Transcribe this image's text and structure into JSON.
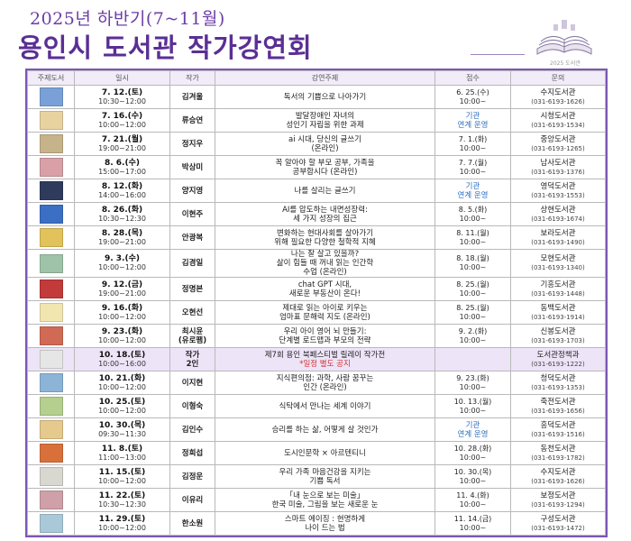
{
  "header": {
    "subtitle": "2025년 하반기(7~11월)",
    "title": "용인시 도서관 작가강연회",
    "logo_caption": "2025 도서관",
    "logo_icon": "open-book-icon",
    "accent": "#5a2f94"
  },
  "table": {
    "columns": [
      "주제도서",
      "일시",
      "작가",
      "강연주제",
      "접수",
      "문의"
    ],
    "rows": [
      {
        "cover": "#7aa0d8",
        "date": "7. 12.(토)",
        "time": "10:30~12:00",
        "author": "김겨울",
        "topic": [
          "독서의 기쁨으로 나아가기"
        ],
        "apply": [
          "6. 25.(수)",
          "10:00~"
        ],
        "apply_note": "",
        "library": "수지도서관",
        "phone": "(031-6193-1626)"
      },
      {
        "cover": "#e8d3a0",
        "date": "7. 16.(수)",
        "time": "10:00~12:00",
        "author": "류승연",
        "topic": [
          "발달장애인 자녀의",
          "성인기 자립을 위한 과제"
        ],
        "apply": [],
        "apply_note": "기관\n연계 운영",
        "library": "시청도서관",
        "phone": "(031-6193-1534)"
      },
      {
        "cover": "#c7b38a",
        "date": "7. 21.(월)",
        "time": "19:00~21:00",
        "author": "정지우",
        "topic": [
          "ai 시대, 당신의 글쓰기",
          "(온라인)"
        ],
        "apply": [
          "7. 1.(화)",
          "10:00~"
        ],
        "apply_note": "",
        "library": "중앙도서관",
        "phone": "(031-6193-1265)"
      },
      {
        "cover": "#d9a0a8",
        "date": "8. 6.(수)",
        "time": "15:00~17:00",
        "author": "박상미",
        "topic": [
          "꼭 알아야 할 부모 공부, 가족을",
          "공부합시다 (온라인)"
        ],
        "apply": [
          "7. 7.(월)",
          "10:00~"
        ],
        "apply_note": "",
        "library": "남사도서관",
        "phone": "(031-6193-1376)"
      },
      {
        "cover": "#2f3b5c",
        "date": "8. 12.(화)",
        "time": "14:00~16:00",
        "author": "양지영",
        "topic": [
          "나를 살리는 글쓰기"
        ],
        "apply": [],
        "apply_note": "기관\n연계 운영",
        "library": "영덕도서관",
        "phone": "(031-6193-1553)"
      },
      {
        "cover": "#3a6fc4",
        "date": "8. 26.(화)",
        "time": "10:30~12:30",
        "author": "이현주",
        "topic": [
          "AI를 압도하는 내면성장력:",
          "세 가지 성장의 집근"
        ],
        "apply": [
          "8. 5.(화)",
          "10:00~"
        ],
        "apply_note": "",
        "library": "상현도서관",
        "phone": "(031-6193-1674)"
      },
      {
        "cover": "#e2c25a",
        "date": "8. 28.(목)",
        "time": "19:00~21:00",
        "author": "안광복",
        "topic": [
          "변화하는 현대사회를 살아가기",
          "위해 필요한 다양한 철학적 지혜"
        ],
        "apply": [
          "8. 11.(월)",
          "10:00~"
        ],
        "apply_note": "",
        "library": "보라도서관",
        "phone": "(031-6193-1490)"
      },
      {
        "cover": "#9fc3a8",
        "date": "9. 3.(수)",
        "time": "10:00~12:00",
        "author": "김경일",
        "topic": [
          "나는 잘 살고 있을까?",
          "삶이 힘들 때 꺼내 읽는 인간학",
          "수업 (온라인)"
        ],
        "apply": [
          "8. 18.(월)",
          "10:00~"
        ],
        "apply_note": "",
        "library": "모현도서관",
        "phone": "(031-6193-1340)"
      },
      {
        "cover": "#c23a3a",
        "date": "9. 12.(금)",
        "time": "19:00~21:00",
        "author": "정명본",
        "topic": [
          "chat GPT 시대,",
          "새로운 부동산이 온다!"
        ],
        "apply": [
          "8. 25.(월)",
          "10:00~"
        ],
        "apply_note": "",
        "library": "기흥도서관",
        "phone": "(031-6193-1448)"
      },
      {
        "cover": "#f2e6b0",
        "date": "9. 16.(화)",
        "time": "10:00~12:00",
        "author": "오현선",
        "topic": [
          "제대로 읽는 아이로 키우는",
          "엄마표 문해력 지도 (온라인)"
        ],
        "apply": [
          "8. 25.(월)",
          "10:00~"
        ],
        "apply_note": "",
        "library": "동백도서관",
        "phone": "(031-6193-1914)"
      },
      {
        "cover": "#d06a55",
        "date": "9. 23.(화)",
        "time": "10:00~12:00",
        "author": "최시윤\n(유로팸)",
        "topic": [
          "우리 아이 영어 뇌 만들기:",
          "단계별 로드맵과 부모의 전략"
        ],
        "apply": [
          "9. 2.(화)",
          "10:00~"
        ],
        "apply_note": "",
        "library": "신봉도서관",
        "phone": "(031-6193-1703)"
      },
      {
        "cover": "#e6e6e6",
        "date": "10. 18.(토)",
        "time": "10:00~16:00",
        "author": "작가\n2인",
        "topic": [
          "제7회 용인 북페스티벌 릴레이 작가전"
        ],
        "topic_note": "*일정 별도 공지",
        "apply": [],
        "apply_note": "",
        "library": "도서관정책과",
        "phone": "(031-6193-1222)",
        "highlight": true
      },
      {
        "cover": "#8cb4d6",
        "date": "10. 21.(화)",
        "time": "10:00~12:00",
        "author": "이지현",
        "topic": [
          "지식편의점: 과학, 사람 꿈꾸는",
          "인간 (온라인)"
        ],
        "apply": [
          "9. 23.(화)",
          "10:00~"
        ],
        "apply_note": "",
        "library": "청덕도서관",
        "phone": "(031-6193-1353)"
      },
      {
        "cover": "#b4cf8e",
        "date": "10. 25.(토)",
        "time": "10:00~12:00",
        "author": "이형숙",
        "topic": [
          "식탁에서 만나는 세계 이야기"
        ],
        "apply": [
          "10. 13.(월)",
          "10:00~"
        ],
        "apply_note": "",
        "library": "죽전도서관",
        "phone": "(031-6193-1656)"
      },
      {
        "cover": "#e6c98c",
        "date": "10. 30.(목)",
        "time": "09:30~11:30",
        "author": "김인수",
        "topic": [
          "승리를 하는 삶, 어떻게 살 것인가"
        ],
        "apply": [],
        "apply_note": "기관\n연계 운영",
        "library": "흥덕도서관",
        "phone": "(031-6193-1516)"
      },
      {
        "cover": "#d9703a",
        "date": "11. 8.(토)",
        "time": "11:00~13:00",
        "author": "정희섭",
        "topic": [
          "도시인문학 × 아르텐티니"
        ],
        "apply": [
          "10. 28.(화)",
          "10:00~"
        ],
        "apply_note": "",
        "library": "동천도서관",
        "phone": "(031-6193-1782)"
      },
      {
        "cover": "#d8d8d0",
        "date": "11. 15.(토)",
        "time": "10:00~12:00",
        "author": "김정운",
        "topic": [
          "우리 가족 마음건강을 지키는",
          "기쁨 독서"
        ],
        "apply": [
          "10. 30.(목)",
          "10:00~"
        ],
        "apply_note": "",
        "library": "수지도서관",
        "phone": "(031-6193-1626)"
      },
      {
        "cover": "#cfa0a8",
        "date": "11. 22.(토)",
        "time": "10:30~12:30",
        "author": "이유리",
        "topic": [
          "「내 눈으로 보는 미술」",
          "한국 미술, 그림을 보는 새로운 눈"
        ],
        "apply": [
          "11. 4.(화)",
          "10:00~"
        ],
        "apply_note": "",
        "library": "보정도서관",
        "phone": "(031-6193-1294)"
      },
      {
        "cover": "#a9c9d8",
        "date": "11. 29.(토)",
        "time": "10:00~12:00",
        "author": "한소원",
        "topic": [
          "스마트 에이징 : 현명하게",
          "나이 드는 법"
        ],
        "apply": [
          "11. 14.(금)",
          "10:00~"
        ],
        "apply_note": "",
        "library": "구성도서관",
        "phone": "(031-6193-1472)"
      }
    ]
  }
}
